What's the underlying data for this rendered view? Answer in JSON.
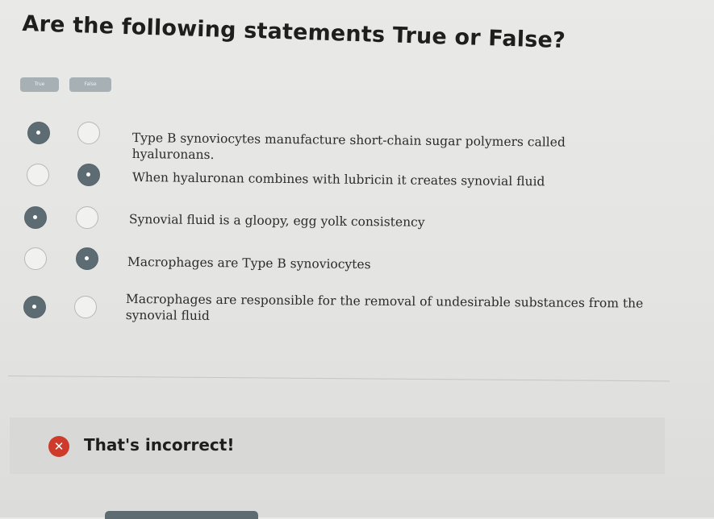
{
  "question": {
    "title": "Are the following statements True or False?"
  },
  "columns": {
    "true_label": "True",
    "false_label": "False"
  },
  "statements": [
    {
      "text": "Type B synoviocytes manufacture short-chain sugar polymers called hyaluronans.",
      "selected": "true"
    },
    {
      "text": "When hyaluronan combines with lubricin it creates synovial fluid",
      "selected": "false"
    },
    {
      "text": "Synovial fluid is a gloopy, egg yolk consistency",
      "selected": "true"
    },
    {
      "text": "Macrophages are Type B synoviocytes",
      "selected": "false"
    },
    {
      "text": "Macrophages are responsible for the removal of undesirable substances from the synovial fluid",
      "selected": "true"
    }
  ],
  "feedback": {
    "icon": "close-icon",
    "message": "That's incorrect!",
    "color": "#cf3b2b"
  }
}
